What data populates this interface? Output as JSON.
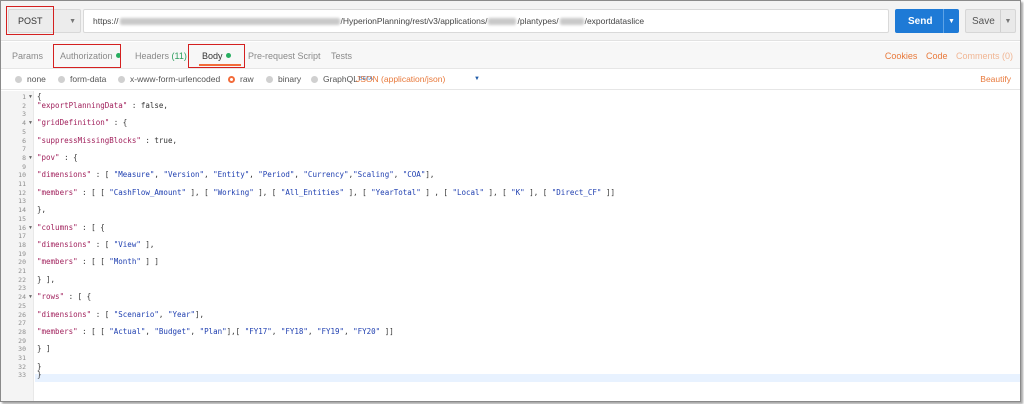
{
  "request": {
    "method": "POST",
    "url_prefix": "https://",
    "url_middle": "/HyperionPlanning/rest/v3/applications/",
    "url_mid2": "/plantypes/",
    "url_suffix": "/exportdataslice",
    "send_label": "Send",
    "save_label": "Save"
  },
  "tabs": [
    {
      "label": "Params"
    },
    {
      "label": "Authorization"
    },
    {
      "label": "Headers",
      "count": "(11)"
    },
    {
      "label": "Body"
    },
    {
      "label": "Pre-request Script"
    },
    {
      "label": "Tests"
    }
  ],
  "right_links": {
    "cookies": "Cookies",
    "code": "Code",
    "comments": "Comments (0)"
  },
  "body_types": [
    "none",
    "form-data",
    "x-www-form-urlencoded",
    "raw",
    "binary",
    "GraphQL"
  ],
  "graphql_badge": "BETA",
  "content_type": "JSON (application/json)",
  "beautify": "Beautify",
  "code_lines": [
    "{",
    "\"exportPlanningData\" : false,",
    "",
    "\"gridDefinition\" : {",
    "",
    "\"suppressMissingBlocks\" : true,",
    "",
    "\"pov\" : {",
    "",
    "\"dimensions\" : [ \"Measure\", \"Version\", \"Entity\", \"Period\", \"Currency\",\"Scaling\", \"COA\"],",
    "",
    "\"members\" : [ [ \"CashFlow_Amount\" ], [ \"Working\" ], [ \"All_Entities\" ], [ \"YearTotal\" ] , [ \"Local\" ], [ \"K\" ], [ \"Direct_CF\" ]]",
    "",
    "},",
    "",
    "\"columns\" : [ {",
    "",
    "\"dimensions\" : [ \"View\" ],",
    "",
    "\"members\" : [ [ \"Month\" ] ]",
    "",
    "} ],",
    "",
    "\"rows\" : [ {",
    "",
    "\"dimensions\" : [ \"Scenario\", \"Year\"],",
    "",
    "\"members\" : [ [ \"Actual\", \"Budget\", \"Plan\"],[ \"FY17\", \"FY18\", \"FY19\", \"FY20\" ]]",
    "",
    "} ]",
    "",
    "}",
    "}"
  ],
  "fold_lines": [
    1,
    4,
    8,
    16,
    24
  ],
  "colors": {
    "send": "#1e7ad6",
    "accent": "#f26b3a",
    "highlight": "#d42020",
    "key": "#a01f5b",
    "string": "#1f3fb0"
  }
}
